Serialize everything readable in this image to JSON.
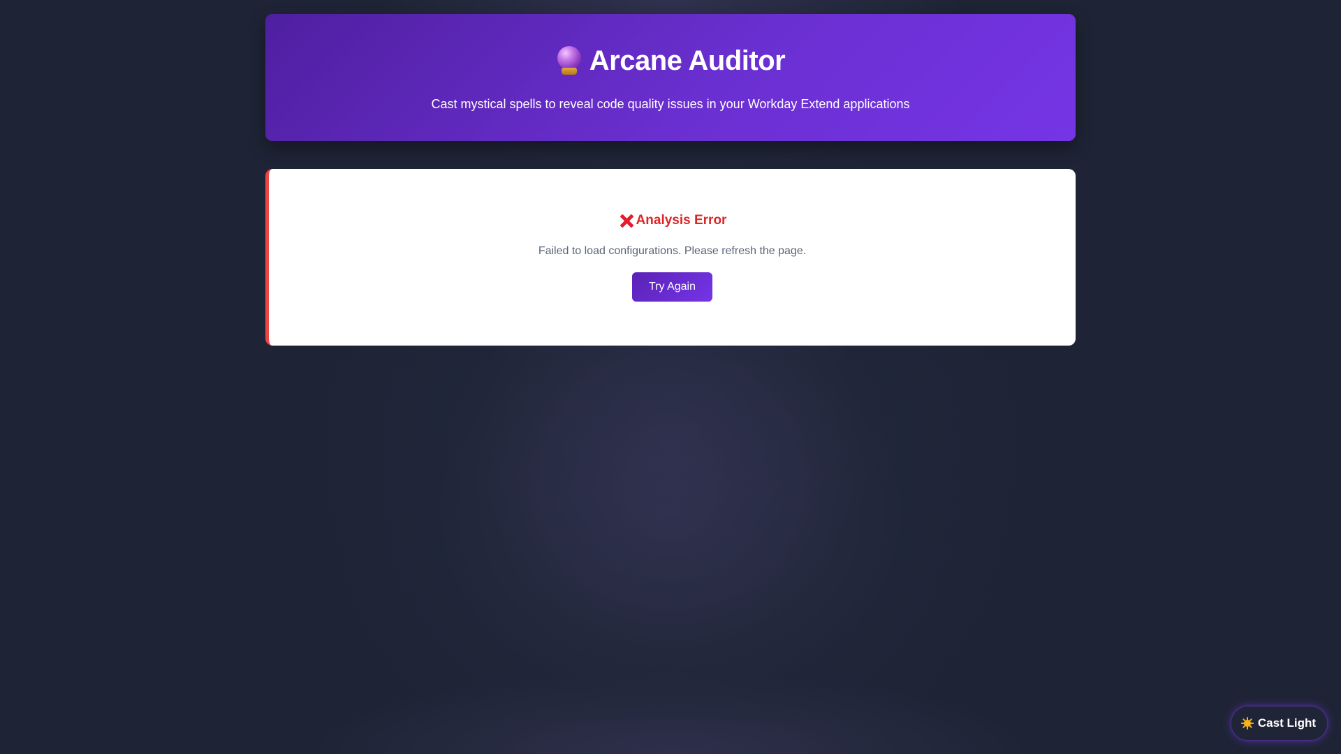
{
  "header": {
    "title": "Arcane Auditor",
    "subtitle": "Cast mystical spells to reveal code quality issues in your Workday Extend applications",
    "icon": "crystal-ball-icon"
  },
  "error": {
    "icon": "cross-mark-icon",
    "title": "Analysis Error",
    "message": "Failed to load configurations. Please refresh the page.",
    "retry_label": "Try Again"
  },
  "theme_toggle": {
    "icon": "sun-icon",
    "label": "Cast Light"
  },
  "colors": {
    "header_gradient_start": "#4f1fa0",
    "header_gradient_end": "#7535e6",
    "error_red": "#dc2626",
    "error_border": "#ef4444",
    "background": "#1e2435",
    "button_gradient_end": "#7535e6"
  }
}
